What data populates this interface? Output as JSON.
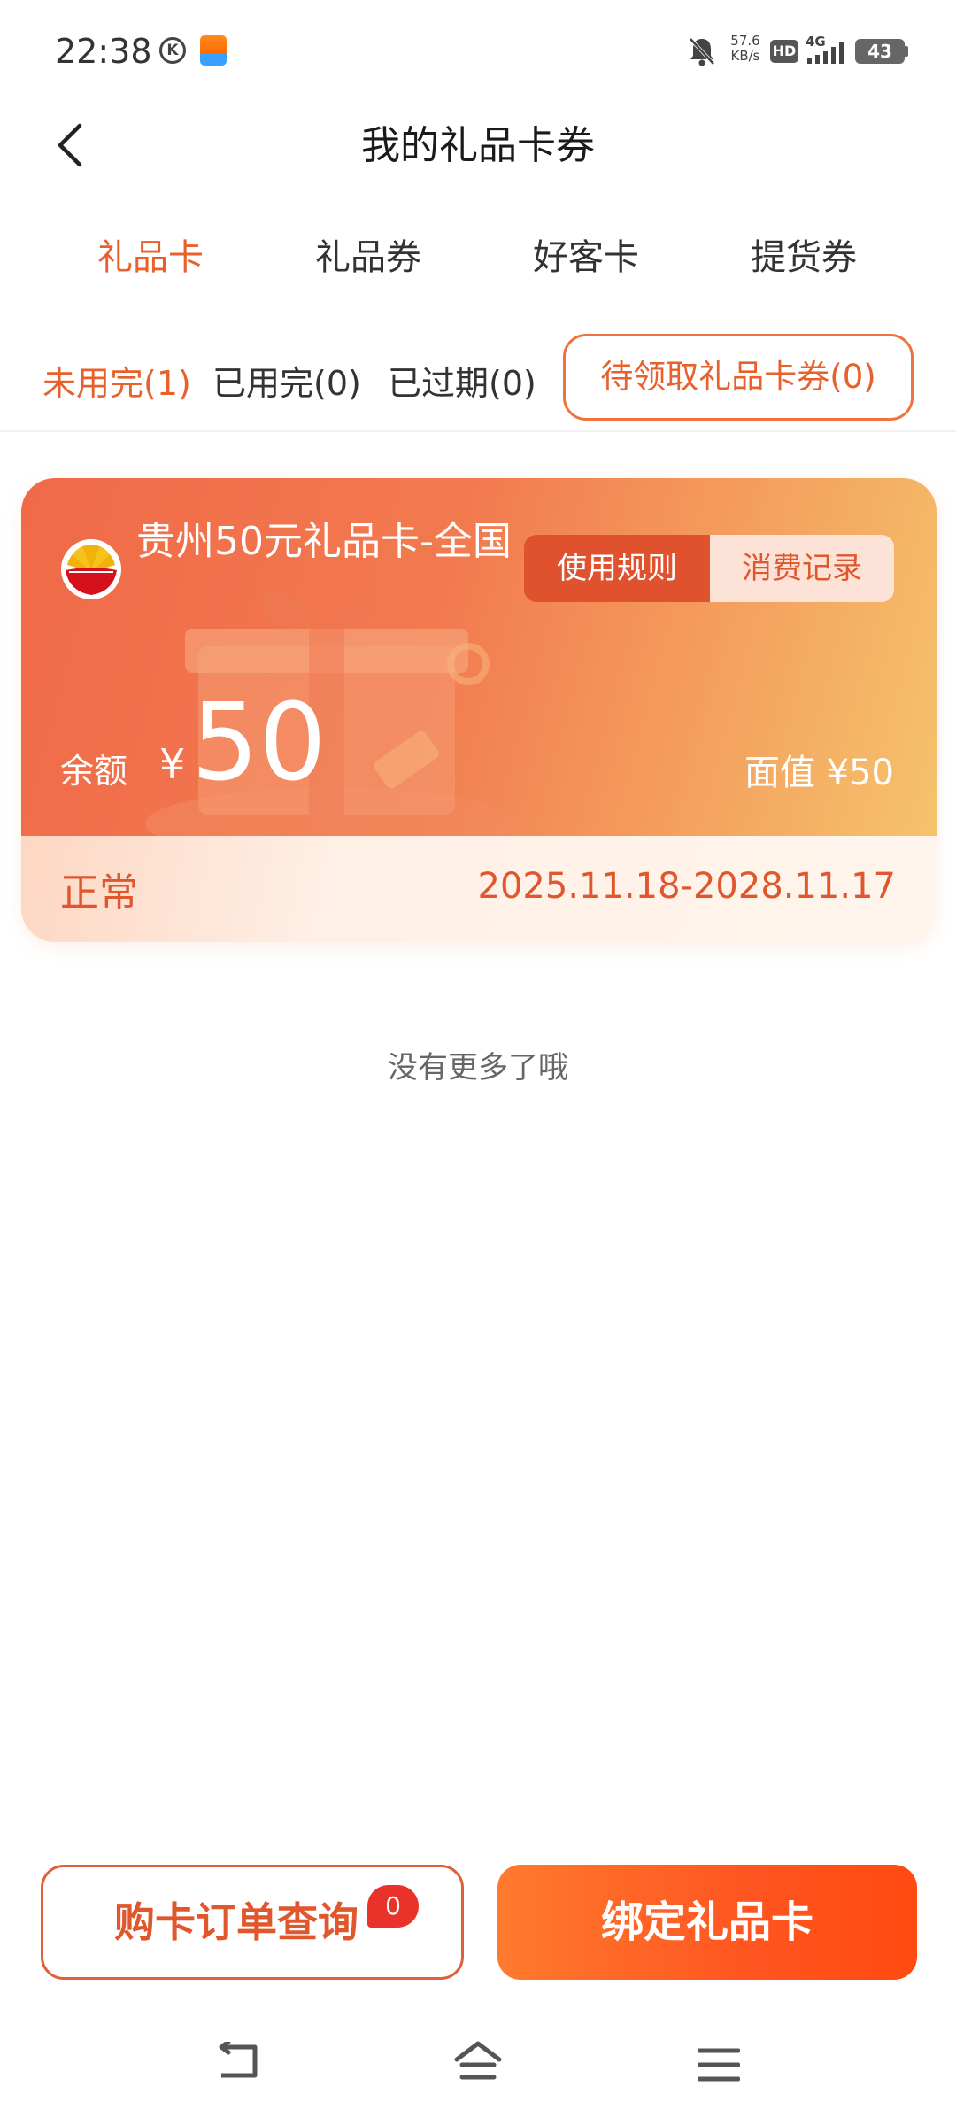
{
  "status_bar": {
    "time": "22:38",
    "k_label": "K",
    "net_speed_value": "57.6",
    "net_speed_unit": "KB/s",
    "hd_label": "HD",
    "network_label": "4G",
    "battery_level": "43"
  },
  "header": {
    "title": "我的礼品卡券"
  },
  "tabs": [
    {
      "label": "礼品卡",
      "active": true
    },
    {
      "label": "礼品券",
      "active": false
    },
    {
      "label": "好客卡",
      "active": false
    },
    {
      "label": "提货券",
      "active": false
    }
  ],
  "filters": [
    {
      "label": "未用完(1)",
      "active": true
    },
    {
      "label": "已用完(0)",
      "active": false
    },
    {
      "label": "已过期(0)",
      "active": false
    }
  ],
  "pending_button_label": "待领取礼品卡券(0)",
  "card": {
    "title": "贵州50元礼品卡-全国",
    "rules_label": "使用规则",
    "records_label": "消费记录",
    "balance_label": "余额",
    "currency": "¥",
    "balance_amount": "50",
    "face_value": "面值 ¥50",
    "status": "正常",
    "validity": "2025.11.18-2028.11.17"
  },
  "list_end_text": "没有更多了哦",
  "bottom": {
    "order_button_label": "购卡订单查询",
    "order_badge_count": "0",
    "bind_button_label": "绑定礼品卡"
  },
  "colors": {
    "accent": "#e8612c",
    "card_gradient_start": "#f06a48",
    "card_gradient_end": "#f5c36c",
    "bind_button": "#ff5520",
    "badge": "#e8322a"
  },
  "icons": {
    "back": "chevron-left-icon",
    "brand": "petrochina-logo-icon",
    "nav_back": "nav-back-icon",
    "nav_home": "nav-home-icon",
    "nav_menu": "nav-menu-icon"
  }
}
